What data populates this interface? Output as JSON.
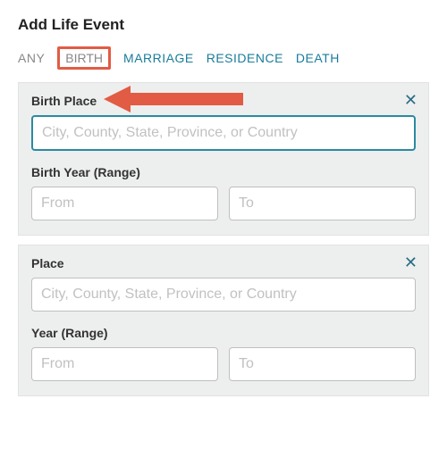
{
  "title": "Add Life Event",
  "tabs": {
    "any": "ANY",
    "birth": "BIRTH",
    "marriage": "MARRIAGE",
    "residence": "RESIDENCE",
    "death": "DEATH"
  },
  "panels": [
    {
      "place_label": "Birth Place",
      "place_placeholder": "City, County, State, Province, or Country",
      "year_label": "Birth Year (Range)",
      "from_placeholder": "From",
      "to_placeholder": "To",
      "close": "✕"
    },
    {
      "place_label": "Place",
      "place_placeholder": "City, County, State, Province, or Country",
      "year_label": "Year (Range)",
      "from_placeholder": "From",
      "to_placeholder": "To",
      "close": "✕"
    }
  ]
}
